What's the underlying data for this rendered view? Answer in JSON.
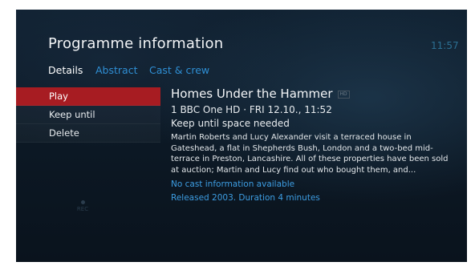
{
  "header": {
    "title": "Programme information",
    "clock": "11:57"
  },
  "tabs": [
    {
      "label": "Details",
      "active": true
    },
    {
      "label": "Abstract",
      "active": false
    },
    {
      "label": "Cast & crew",
      "active": false
    }
  ],
  "menu": {
    "items": [
      {
        "label": "Play",
        "selected": true
      },
      {
        "label": "Keep until",
        "selected": false
      },
      {
        "label": "Delete",
        "selected": false
      }
    ]
  },
  "rec_indicator": {
    "label": "REC",
    "icon": "rec-dot-icon"
  },
  "programme": {
    "title": "Homes Under the Hammer",
    "badge": "HD",
    "channel_line": "1 BBC One HD  · FRI 12.10., 11:52",
    "keep_status": "Keep until space needed",
    "synopsis": "Martin Roberts and Lucy Alexander visit a terraced house in Gateshead, a flat in Shepherds Bush, London and a two-bed mid-terrace in Preston, Lancashire. All of these properties have been sold at auction; Martin and Lucy find out who bought them, and...",
    "cast_note": "No cast information available",
    "release_info": "Released 2003. Duration 4 minutes"
  },
  "colors": {
    "background": "#0c1824",
    "selected_item": "#a71c22",
    "link_blue": "#2f8fd4",
    "clock": "#2c6f92"
  }
}
